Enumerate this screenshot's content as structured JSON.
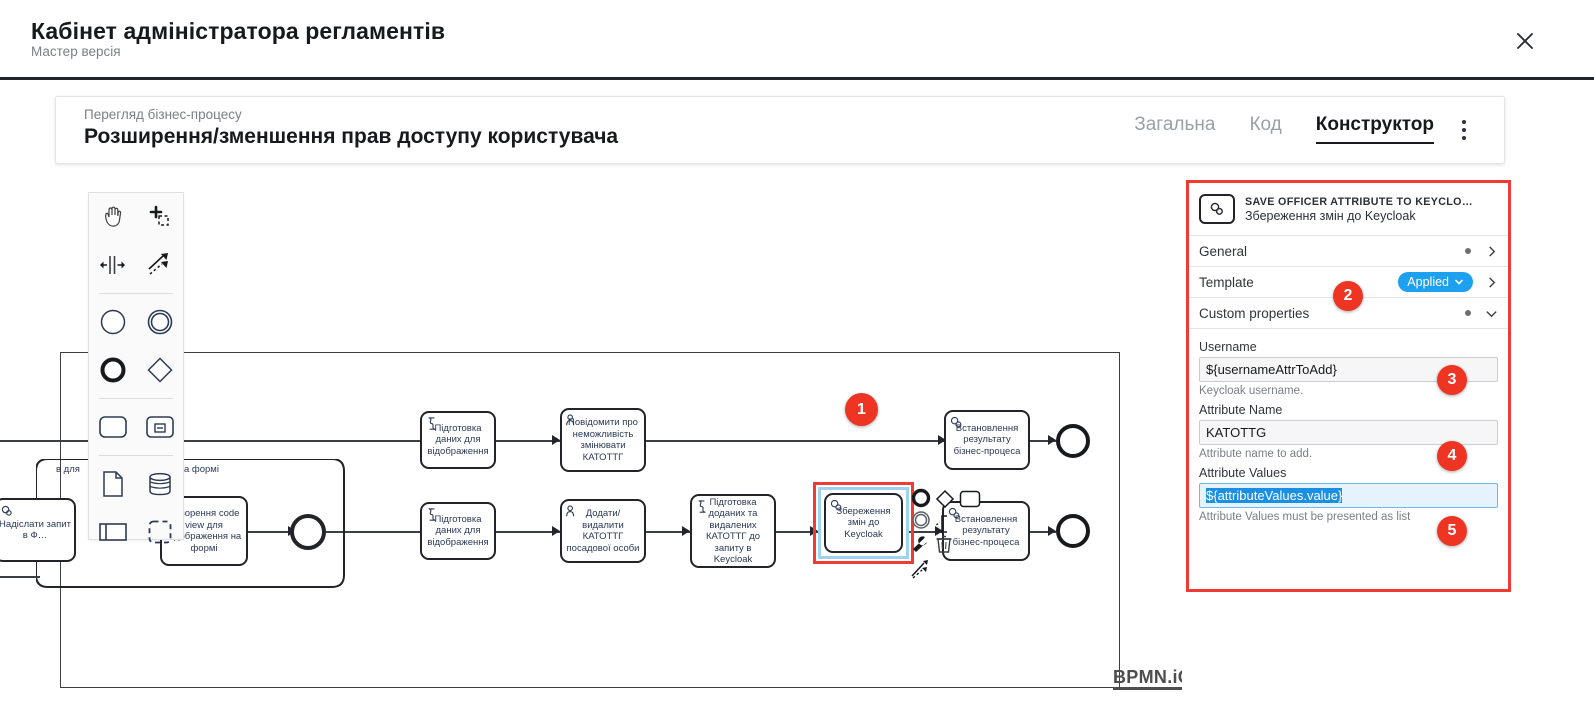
{
  "app": {
    "title": "Кабінет адміністратора регламентів",
    "subtitle": "Мастер версія",
    "close_icon": "close-icon"
  },
  "card": {
    "breadcrumb": "Перегляд бізнес-процесу",
    "title": "Розширення/зменшення прав доступу користувача",
    "tabs": [
      {
        "label": "Загальна",
        "active": false
      },
      {
        "label": "Код",
        "active": false
      },
      {
        "label": "Конструктор",
        "active": true
      }
    ],
    "overflow_icon": "kebab-menu-icon"
  },
  "palette": {
    "items": [
      {
        "name": "hand-tool-icon",
        "label": "Activate the hand tool"
      },
      {
        "name": "lasso-tool-icon",
        "label": "Activate the lasso tool"
      },
      {
        "name": "space-tool-icon",
        "label": "Activate the create/remove space tool"
      },
      {
        "name": "global-connect-tool-icon",
        "label": "Activate the global connect tool"
      },
      {
        "name": "start-event-icon",
        "label": "Create StartEvent"
      },
      {
        "name": "intermediate-event-icon",
        "label": "Create Intermediate/Boundary Event"
      },
      {
        "name": "end-event-icon",
        "label": "Create EndEvent"
      },
      {
        "name": "gateway-icon",
        "label": "Create Gateway"
      },
      {
        "name": "task-icon",
        "label": "Create Task"
      },
      {
        "name": "subprocess-collapsed-icon",
        "label": "Create expanded SubProcess"
      },
      {
        "name": "data-object-icon",
        "label": "Create DataObjectReference"
      },
      {
        "name": "data-store-icon",
        "label": "Create DataStoreReference"
      },
      {
        "name": "participant-icon",
        "label": "Create Pool/Participant"
      },
      {
        "name": "group-icon",
        "label": "Create Group"
      }
    ]
  },
  "context_pad": {
    "items": [
      {
        "name": "append-end-event-icon"
      },
      {
        "name": "append-gateway-icon"
      },
      {
        "name": "append-task-icon"
      },
      {
        "name": "append-intermediate-event-icon"
      },
      {
        "name": "append-text-annotation-icon"
      },
      {
        "name": "change-type-wrench-icon"
      },
      {
        "name": "delete-trash-icon"
      },
      {
        "name": "connect-tool-icon"
      }
    ]
  },
  "diagram": {
    "watermark": "BPMN.iO",
    "nodes": [
      {
        "id": "n_partial_left1",
        "label": "в для",
        "type": "partial-text"
      },
      {
        "id": "n_partial_left2",
        "label": "а формі",
        "type": "partial-text"
      },
      {
        "id": "n_partial_left3",
        "label": "Надіслати запит в Ф…",
        "type": "service-task"
      },
      {
        "id": "n_codeview",
        "label": "Створення code view для відображення на формі",
        "type": "user-task"
      },
      {
        "id": "n_top_prep",
        "label": "Підготовка даних для відображення",
        "type": "script-task"
      },
      {
        "id": "n_top_notify",
        "label": "Повідомити про неможливість змінювати КАТОТТГ",
        "type": "user-task"
      },
      {
        "id": "n_top_result",
        "label": "Встановлення результату бізнес-процеса",
        "type": "service-task"
      },
      {
        "id": "n_bot_prep",
        "label": "Підготовка даних для відображення",
        "type": "script-task"
      },
      {
        "id": "n_bot_addremove",
        "label": "Додати/видалити КАТОТТГ посадової особи",
        "type": "user-task"
      },
      {
        "id": "n_bot_prepreq",
        "label": "Підготовка доданих та видалених КАТОТТГ до запиту в Keycloak",
        "type": "script-task"
      },
      {
        "id": "n_selected",
        "label": "Збереження змін до Keycloak",
        "type": "service-task",
        "selected": true
      },
      {
        "id": "n_bot_result",
        "label": "Встановлення результату бізнес-процеса",
        "type": "service-task"
      }
    ]
  },
  "properties_panel": {
    "header": {
      "icon": "service-task-gear-icon",
      "title": "SAVE OFFICER ATTRIBUTE TO KEYCLO…",
      "subtitle": "Збереження змін до Keycloak"
    },
    "groups": [
      {
        "name": "General",
        "label": "General",
        "expanded": false,
        "badge": null
      },
      {
        "name": "Template",
        "label": "Template",
        "expanded": false,
        "badge": "Applied"
      },
      {
        "name": "Custom properties",
        "label": "Custom properties",
        "expanded": true,
        "badge": null
      }
    ],
    "fields": [
      {
        "label": "Username",
        "value": "${usernameAttrToAdd}",
        "help": "Keycloak username.",
        "selected": false
      },
      {
        "label": "Attribute Name",
        "value": "KATOTTG",
        "help": "Attribute name to add.",
        "selected": false
      },
      {
        "label": "Attribute Values",
        "value": "${attributeValues.value}",
        "help": "Attribute Values must be presented as list",
        "selected": true
      }
    ]
  },
  "annotations": [
    {
      "number": "1"
    },
    {
      "number": "2"
    },
    {
      "number": "3"
    },
    {
      "number": "4"
    },
    {
      "number": "5"
    }
  ],
  "colors": {
    "accent_red": "#ef3b33",
    "badge_blue": "#1ea0f0",
    "bubble_red": "#ee3524",
    "selection_blue": "#9fd2ef"
  }
}
